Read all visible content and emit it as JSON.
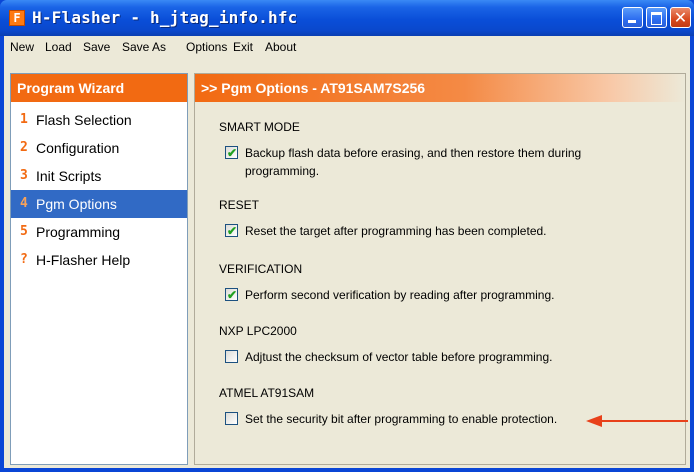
{
  "window": {
    "title": "H-Flasher - h_jtag_info.hfc",
    "icon_letter": "F"
  },
  "menu": [
    "New",
    "Load",
    "Save",
    "Save As",
    "Options",
    "Exit",
    "About"
  ],
  "wizard": {
    "title": "Program Wizard",
    "items": [
      {
        "num": "1",
        "label": "Flash Selection"
      },
      {
        "num": "2",
        "label": "Configuration"
      },
      {
        "num": "3",
        "label": "Init Scripts"
      },
      {
        "num": "4",
        "label": "Pgm Options"
      },
      {
        "num": "5",
        "label": "Programming"
      },
      {
        "num": "?",
        "label": "H-Flasher Help"
      }
    ],
    "selected": "Pgm Options"
  },
  "panel": {
    "title": ">> Pgm Options - AT91SAM7S256",
    "sections": [
      {
        "title": "SMART MODE",
        "option": "Backup flash data before erasing, and then restore them during programming.",
        "checked": true
      },
      {
        "title": "RESET",
        "option": "Reset the target after programming has been completed.",
        "checked": true
      },
      {
        "title": "VERIFICATION",
        "option": "Perform second verification by reading after programming.",
        "checked": true
      },
      {
        "title": "NXP LPC2000",
        "option": "Adjtust the checksum of vector table before programming.",
        "checked": false
      },
      {
        "title": "ATMEL AT91SAM",
        "option": "Set the security bit after programming to enable protection.",
        "checked": false
      }
    ]
  },
  "colors": {
    "accent": "#f26a12",
    "selection": "#316ac5",
    "annotation_arrow": "#e8411a"
  }
}
